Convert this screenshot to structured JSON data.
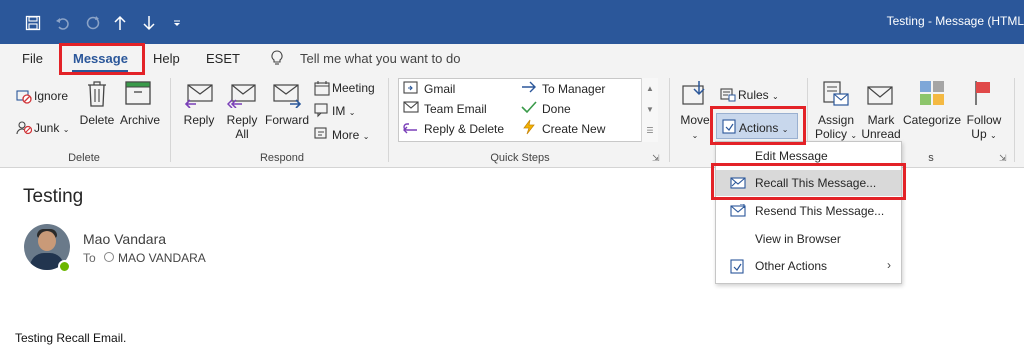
{
  "window": {
    "title": "Testing  -  Message (HTML"
  },
  "quick_access": {
    "icons": [
      "save-icon",
      "undo-icon",
      "redo-icon",
      "up-arrow-icon",
      "down-arrow-icon",
      "customize-icon"
    ]
  },
  "tabs": [
    {
      "label": "File"
    },
    {
      "label": "Message",
      "active": true
    },
    {
      "label": "Help"
    },
    {
      "label": "ESET"
    }
  ],
  "tell_me": "Tell me what you want to do",
  "ribbon": {
    "delete_group": {
      "label": "Delete",
      "ignore": "Ignore",
      "junk": "Junk",
      "delete": "Delete",
      "archive": "Archive"
    },
    "respond_group": {
      "label": "Respond",
      "reply": "Reply",
      "reply_all_line1": "Reply",
      "reply_all_line2": "All",
      "forward": "Forward",
      "meeting": "Meeting",
      "im": "IM",
      "more": "More"
    },
    "quick_steps_group": {
      "label": "Quick Steps",
      "items": [
        "Gmail",
        "Team Email",
        "Reply & Delete",
        "To Manager",
        "Done",
        "Create New"
      ]
    },
    "move_group": {
      "move": "Move",
      "rules": "Rules",
      "actions": "Actions"
    },
    "tags_group": {
      "label_partial": "s",
      "assign_line1": "Assign",
      "assign_line2": "Policy",
      "mark_line1": "Mark",
      "mark_line2": "Unread",
      "categorize": "Categorize",
      "follow_line1": "Follow",
      "follow_line2": "Up"
    }
  },
  "actions_menu": {
    "items": [
      {
        "label": "Edit Message",
        "icon": ""
      },
      {
        "label": "Recall This Message...",
        "icon": "recall-icon",
        "highlighted": true
      },
      {
        "label": "Resend This Message...",
        "icon": "resend-icon"
      },
      {
        "label": "View in Browser",
        "icon": ""
      },
      {
        "label": "Other Actions",
        "icon": "other-actions-icon",
        "submenu": true
      }
    ]
  },
  "message": {
    "subject": "Testing",
    "sender": "Mao Vandara",
    "to_label": "To",
    "recipient": "MAO VANDARA",
    "body": "Testing Recall Email."
  },
  "colors": {
    "accent": "#2b579a",
    "annotation_red": "#e32227",
    "presence_green": "#6bb700"
  }
}
